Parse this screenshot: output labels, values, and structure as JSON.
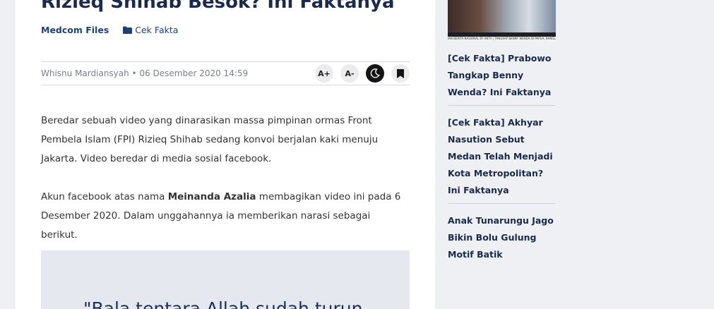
{
  "article": {
    "title": "Rizieq Shihab Besok? Ini Faktanya",
    "source": "Medcom Files",
    "category": "Cek Fakta",
    "byline": "Whisnu Mardiansyah • 06 Desember 2020 14:59",
    "tools": {
      "increase_font": "A+",
      "decrease_font": "A-"
    },
    "paragraphs": {
      "p1": "Beredar sebuah video yang dinarasikan massa pimpinan ormas Front Pembela Islam (FPI) Rizieq Shihab sedang konvoi berjalan kaki menuju Jakarta. Video beredar di media sosial facebook.",
      "p2_before": "Akun facebook atas nama ",
      "p2_bold": "Meinanda Azalia",
      "p2_after": " membagikan video ini pada 6 Desember 2020. Dalam unggahannya ia memberikan narasi sebagai berikut."
    },
    "quote": "\"Bala tentara Allah sudah turun"
  },
  "sidebar": {
    "thumb_caption": "IAN BERITA NASIONAL BY ANTV | TANGKAP BENNY WENDA DI PAPUA, BANGLAMA TNI | TERKINI",
    "items": [
      "[Cek Fakta] Prabowo Tangkap Benny Wenda? Ini Faktanya",
      "[Cek Fakta] Akhyar Nasution Sebut Medan Telah Menjadi Kota Metropolitan? Ini Faktanya",
      "Anak Tunarungu Jago Bikin Bolu Gulung Motif Batik"
    ]
  }
}
